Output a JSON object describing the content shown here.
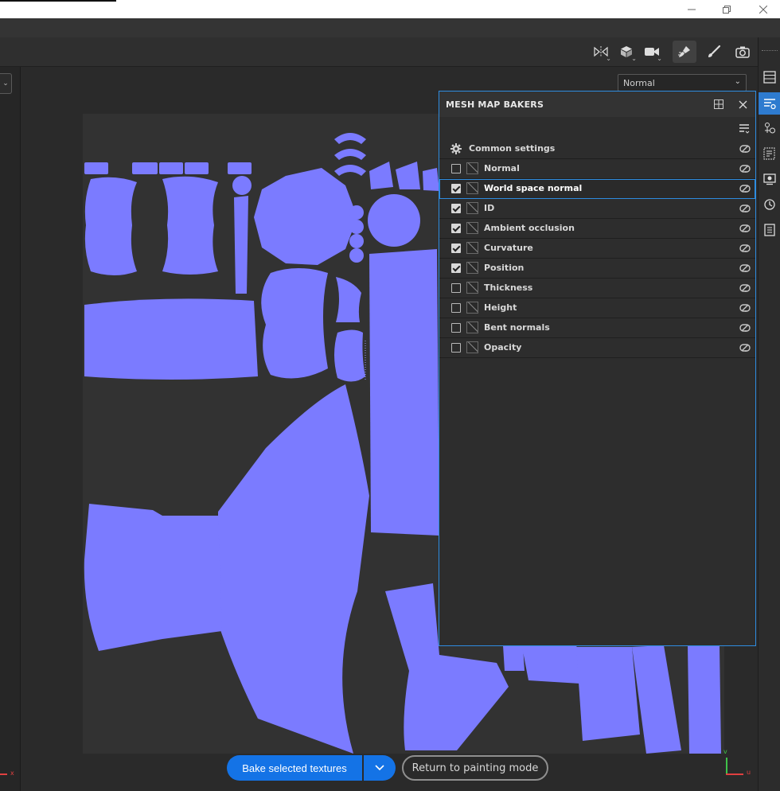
{
  "viewport": {
    "channel_select": "Normal",
    "axis_x": "x",
    "axis_v": "v",
    "axis_u": "u"
  },
  "panel": {
    "title": "MESH MAP BAKERS",
    "common_settings_label": "Common settings",
    "rows": [
      {
        "label": "Normal",
        "checked": false,
        "selected": false
      },
      {
        "label": "World space normal",
        "checked": true,
        "selected": true
      },
      {
        "label": "ID",
        "checked": true,
        "selected": false
      },
      {
        "label": "Ambient occlusion",
        "checked": true,
        "selected": false
      },
      {
        "label": "Curvature",
        "checked": true,
        "selected": false
      },
      {
        "label": "Position",
        "checked": true,
        "selected": false
      },
      {
        "label": "Thickness",
        "checked": false,
        "selected": false
      },
      {
        "label": "Height",
        "checked": false,
        "selected": false
      },
      {
        "label": "Bent normals",
        "checked": false,
        "selected": false
      },
      {
        "label": "Opacity",
        "checked": false,
        "selected": false
      }
    ]
  },
  "actions": {
    "bake_label": "Bake selected textures",
    "return_label": "Return to painting mode"
  },
  "colors": {
    "accent": "#1473e6",
    "uv_island": "#7b7bff",
    "panel_border": "#2e8ce0"
  },
  "icons": {
    "toolbar": [
      "symmetry-icon",
      "cube-icon",
      "camera-video-icon",
      "bake-brush-icon",
      "paint-brush-icon",
      "screenshot-camera-icon"
    ],
    "sidebar": [
      "layers-icon",
      "bakers-icon",
      "shader-icon",
      "properties-icon",
      "display-icon",
      "history-icon",
      "log-icon"
    ]
  }
}
